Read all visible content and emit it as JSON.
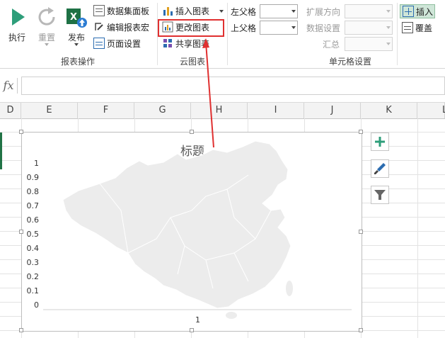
{
  "ribbon": {
    "report_ops": {
      "label": "报表操作",
      "execute": "执行",
      "reset": "重置",
      "publish": "发布",
      "data_panel": "数据集面板",
      "edit_macro": "编辑报表宏",
      "page_setup": "页面设置"
    },
    "cloud_chart": {
      "label": "云图表",
      "insert_chart": "插入图表",
      "change_chart": "更改图表",
      "share_chart": "共享图表"
    },
    "cell_settings": {
      "label": "单元格设置",
      "left_parent": "左父格",
      "top_parent": "上父格",
      "expand_dir": "扩展方向",
      "data_setting": "数据设置",
      "summary": "汇总"
    },
    "insert": "插入",
    "overwrite": "覆盖"
  },
  "formula_bar": {
    "fx": "fx",
    "value": ""
  },
  "columns": [
    "D",
    "E",
    "F",
    "G",
    "H",
    "I",
    "J",
    "K",
    "L"
  ],
  "chart_data": {
    "type": "map",
    "title": "标题",
    "region": "China",
    "y_ticks": [
      "1",
      "0.9",
      "0.8",
      "0.7",
      "0.6",
      "0.5",
      "0.4",
      "0.3",
      "0.2",
      "0.1",
      "0"
    ],
    "x_ticks": [
      "1"
    ],
    "ylim": [
      0,
      1
    ],
    "fill_color": "#ececec",
    "border_color": "#ffffff"
  },
  "chart_tools": [
    "chart-elements-icon",
    "chart-styles-icon",
    "chart-filter-icon"
  ],
  "annotation": {
    "highlight_color": "#e03030"
  }
}
